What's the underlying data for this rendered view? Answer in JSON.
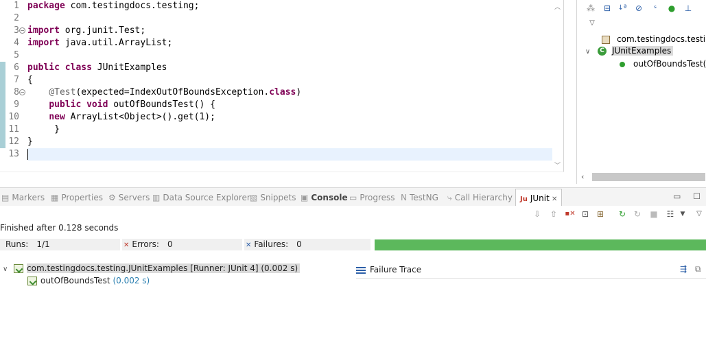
{
  "editor": {
    "lines": [
      {
        "num": "1",
        "fold": "",
        "marker": false,
        "tokens": [
          {
            "t": "package",
            "k": "kw"
          },
          {
            "t": " com.testingdocs.testing;",
            "k": ""
          }
        ]
      },
      {
        "num": "2",
        "fold": "",
        "marker": false,
        "tokens": []
      },
      {
        "num": "3",
        "fold": "⊖",
        "marker": false,
        "tokens": [
          {
            "t": "import",
            "k": "kw"
          },
          {
            "t": " org.junit.Test;",
            "k": ""
          }
        ]
      },
      {
        "num": "4",
        "fold": "",
        "marker": false,
        "tokens": [
          {
            "t": "import",
            "k": "kw"
          },
          {
            "t": " java.util.ArrayList;",
            "k": ""
          }
        ]
      },
      {
        "num": "5",
        "fold": "",
        "marker": false,
        "tokens": []
      },
      {
        "num": "6",
        "fold": "",
        "marker": true,
        "tokens": [
          {
            "t": "public",
            "k": "kw"
          },
          {
            "t": " ",
            "k": ""
          },
          {
            "t": "class",
            "k": "kw"
          },
          {
            "t": " JUnitExamples",
            "k": ""
          }
        ]
      },
      {
        "num": "7",
        "fold": "",
        "marker": true,
        "tokens": [
          {
            "t": "{",
            "k": ""
          }
        ]
      },
      {
        "num": "8",
        "fold": "⊖",
        "marker": true,
        "tokens": [
          {
            "t": "    ",
            "k": ""
          },
          {
            "t": "@Test",
            "k": "an"
          },
          {
            "t": "(expected=IndexOutOfBoundsException.",
            "k": ""
          },
          {
            "t": "class",
            "k": "kw"
          },
          {
            "t": ")",
            "k": ""
          }
        ]
      },
      {
        "num": "9",
        "fold": "",
        "marker": true,
        "tokens": [
          {
            "t": "    ",
            "k": ""
          },
          {
            "t": "public",
            "k": "kw"
          },
          {
            "t": " ",
            "k": ""
          },
          {
            "t": "void",
            "k": "kw"
          },
          {
            "t": " outOfBoundsTest() {",
            "k": ""
          }
        ]
      },
      {
        "num": "10",
        "fold": "",
        "marker": true,
        "tokens": [
          {
            "t": "    ",
            "k": ""
          },
          {
            "t": "new",
            "k": "kw"
          },
          {
            "t": " ArrayList<Object>().get(1);",
            "k": ""
          }
        ]
      },
      {
        "num": "11",
        "fold": "",
        "marker": true,
        "tokens": [
          {
            "t": "     }",
            "k": ""
          }
        ]
      },
      {
        "num": "12",
        "fold": "",
        "marker": true,
        "tokens": [
          {
            "t": "}",
            "k": ""
          }
        ]
      },
      {
        "num": "13",
        "fold": "",
        "marker": false,
        "current": true,
        "tokens": []
      }
    ]
  },
  "outline": {
    "package": "com.testingdocs.testing",
    "class_icon_letter": "C",
    "class_name": "JUnitExamples",
    "method_name": "outOfBoundsTest()"
  },
  "tabs": [
    {
      "label": "Markers",
      "icon": "markers-icon",
      "glyph": "▤"
    },
    {
      "label": "Properties",
      "icon": "properties-icon",
      "glyph": "▦"
    },
    {
      "label": "Servers",
      "icon": "servers-icon",
      "glyph": "⚙"
    },
    {
      "label": "Data Source Explorer",
      "icon": "data-source-icon",
      "glyph": "▥"
    },
    {
      "label": "Snippets",
      "icon": "snippets-icon",
      "glyph": "▧"
    },
    {
      "label": "Console",
      "icon": "console-icon",
      "glyph": "▣",
      "bold": true
    },
    {
      "label": "Progress",
      "icon": "progress-icon",
      "glyph": "▭"
    },
    {
      "label": "TestNG",
      "icon": "testng-icon",
      "glyph": "N"
    },
    {
      "label": "Call Hierarchy",
      "icon": "call-hierarchy-icon",
      "glyph": "⤷"
    },
    {
      "label": "JUnit",
      "icon": "junit-icon",
      "glyph": "Ju",
      "active": true,
      "close": "✕"
    }
  ],
  "junit": {
    "finished": "Finished after 0.128 seconds",
    "runs_label": "Runs:",
    "runs_value": "1/1",
    "errors_label": "Errors:",
    "errors_value": "0",
    "failures_label": "Failures:",
    "failures_value": "0",
    "progress_fraction": 1.0,
    "progress_color": "#5cb85c",
    "suite_label": "com.testingdocs.testing.JUnitExamples [Runner: JUnit 4] (0.002 s)",
    "test_name": "outOfBoundsTest",
    "test_time": "(0.002 s)",
    "failure_trace_label": "Failure Trace"
  }
}
